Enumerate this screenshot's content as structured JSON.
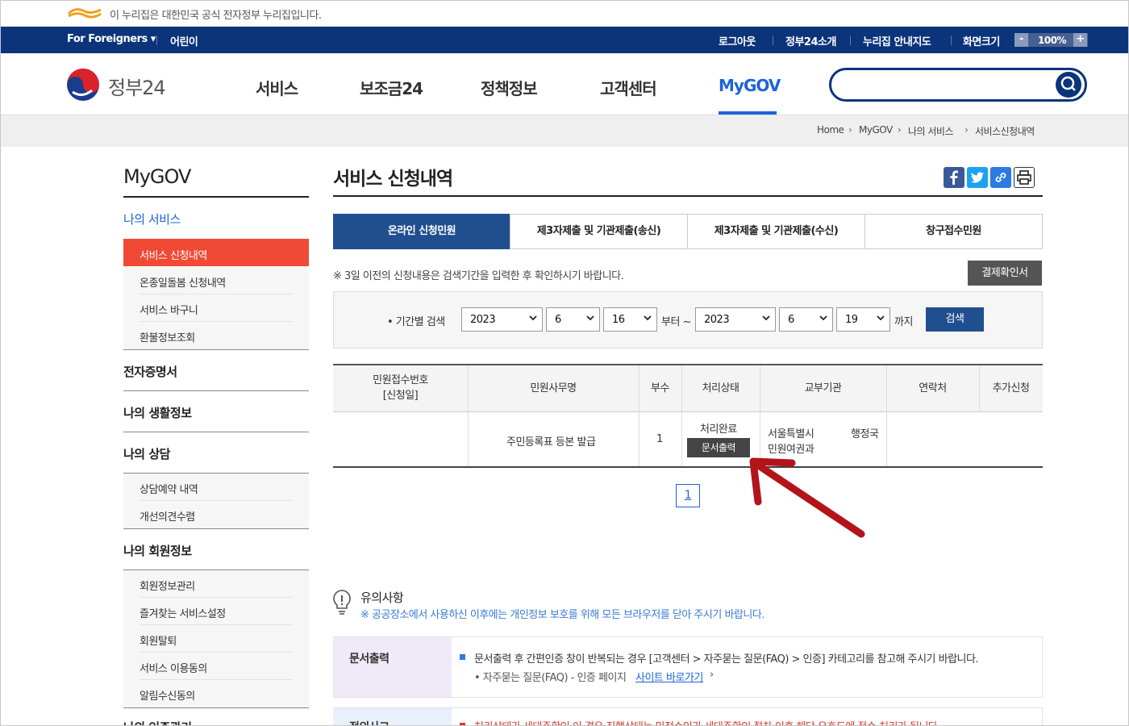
{
  "notice": {
    "text": "이 누리집은 대한민국 공식 전자정부 누리집입니다."
  },
  "util": {
    "for_foreigners": "For Foreigners",
    "kids": "어린이",
    "logout": "로그아웃",
    "about": "정부24소개",
    "guide": "누리집 안내지도",
    "screen_size": "화면크기",
    "zoom_minus": "-",
    "zoom_level": "100%",
    "zoom_plus": "+"
  },
  "brand": {
    "name": "정부24"
  },
  "gnb": {
    "items": [
      "서비스",
      "보조금24",
      "정책정보",
      "고객센터",
      "MyGOV"
    ],
    "active": "MyGOV"
  },
  "search": {
    "placeholder": ""
  },
  "breadcrumb": [
    "Home",
    "MyGOV",
    "나의 서비스",
    "서비스신청내역"
  ],
  "sidebar": {
    "title": "MyGOV",
    "subtitle": "나의 서비스",
    "my_services": [
      "서비스 신청내역",
      "온종일돌봄 신청내역",
      "서비스 바구니",
      "환불정보조회"
    ],
    "sec_certificate": "전자증명서",
    "sec_life": "나의 생활정보",
    "sec_consult": "나의 상담",
    "consult_items": [
      "상담예약 내역",
      "개선의견수렴"
    ],
    "sec_member": "나의 회원정보",
    "member_items": [
      "회원정보관리",
      "즐겨찾는 서비스설정",
      "회원탈퇴",
      "서비스 이용동의",
      "알림수신동의"
    ],
    "sec_cut": "나의 인증관리"
  },
  "main": {
    "title": "서비스 신청내역",
    "tabs": [
      "온라인 신청민원",
      "제3자제출 및 기관제출(송신)",
      "제3자제출 및 기관제출(수신)",
      "창구접수민원"
    ],
    "note": "※ 3일 이전의 신청내용은 검색기간을 입력한 후 확인하시기 바랍니다.",
    "payment_button": "결제확인서",
    "period_label": "• 기간별 검색",
    "from_year": "2023",
    "from_month": "6",
    "from_day": "16",
    "from_text": "부터 ~",
    "to_year": "2023",
    "to_month": "6",
    "to_day": "19",
    "to_text": "까지",
    "search_button": "검색"
  },
  "table": {
    "headers": [
      "민원접수번호",
      "[신청일]",
      "민원사무명",
      "부수",
      "처리상태",
      "교부기관",
      "연락처",
      "추가신청"
    ],
    "row": {
      "name": "주민등록표 등본 발급",
      "copies": "1",
      "status": "처리완료",
      "print_button": "문서출력",
      "agency_line1a": "서울특별시",
      "agency_line1b": "행정국",
      "agency_line2": "민원여권과"
    },
    "page": "1"
  },
  "notes": {
    "title": "유의사항",
    "subtitle": "※ 공공장소에서 사용하신 이후에는 개인정보 보호를 위해 모든 브라우저를 닫아 주시기 바랍니다.",
    "box1_label": "문서출력",
    "box1_text": "문서출력 후 간편인증 창이 반복되는 경우 [고객센터 > 자주묻는 질문(FAQ) > 인증] 카테고리를 참고해 주시기 바랍니다.",
    "box1_sub": "• 자주묻는 질문(FAQ) - 인증 페이지",
    "box1_link": "사이트 바로가기",
    "box2_label": "정의사고",
    "box2_text": "처리상태가 세대주확인 이 경우 진행상태는 민정수인가 세대주확인 절차 이후 해당 유효도에 접수 처리가 됩니다."
  },
  "colors": {
    "navy": "#0b347a",
    "accent": "#1d63d9",
    "active_menu": "#f04a37",
    "tab_on": "#1f4f8f"
  }
}
